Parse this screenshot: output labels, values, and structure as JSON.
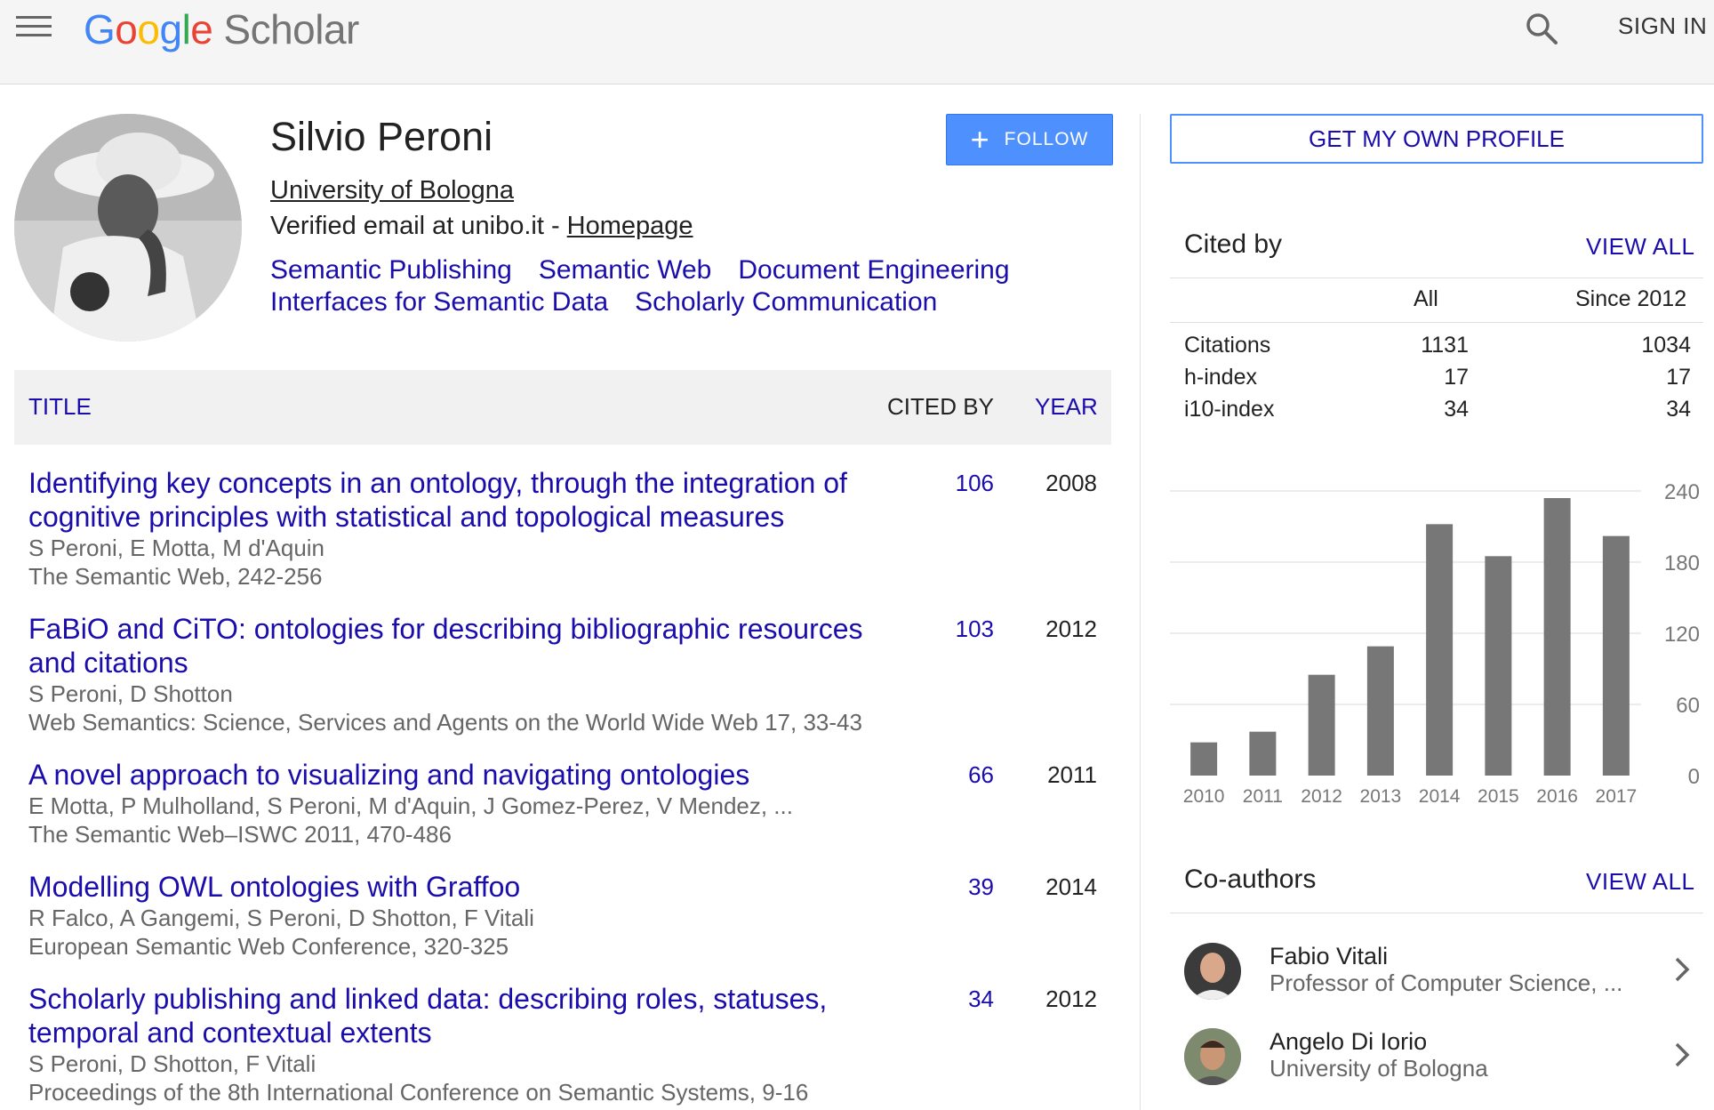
{
  "header": {
    "logo_google": [
      "G",
      "o",
      "o",
      "g",
      "l",
      "e"
    ],
    "logo_product": "Scholar",
    "sign_in": "SIGN IN"
  },
  "profile": {
    "name": "Silvio Peroni",
    "affiliation": "University of Bologna",
    "email_text": "Verified email at unibo.it - ",
    "homepage": "Homepage",
    "follow": "FOLLOW",
    "interests": [
      "Semantic Publishing",
      "Semantic Web",
      "Document Engineering",
      "Interfaces for Semantic Data",
      "Scholarly Communication"
    ]
  },
  "table": {
    "headers": {
      "title": "TITLE",
      "cited_by": "CITED BY",
      "year": "YEAR"
    },
    "rows": [
      {
        "title": "Identifying key concepts in an ontology, through the integration of cognitive principles with statistical and topological measures",
        "authors": "S Peroni, E Motta, M d'Aquin",
        "venue": "The Semantic Web, 242-256",
        "cited": "106",
        "year": "2008"
      },
      {
        "title": "FaBiO and CiTO: ontologies for describing bibliographic resources and citations",
        "authors": "S Peroni, D Shotton",
        "venue": "Web Semantics: Science, Services and Agents on the World Wide Web 17, 33-43",
        "cited": "103",
        "year": "2012"
      },
      {
        "title": "A novel approach to visualizing and navigating ontologies",
        "authors": "E Motta, P Mulholland, S Peroni, M d'Aquin, J Gomez-Perez, V Mendez, ...",
        "venue": "The Semantic Web–ISWC 2011, 470-486",
        "cited": "66",
        "year": "2011"
      },
      {
        "title": "Modelling OWL ontologies with Graffoo",
        "authors": "R Falco, A Gangemi, S Peroni, D Shotton, F Vitali",
        "venue": "European Semantic Web Conference, 320-325",
        "cited": "39",
        "year": "2014"
      },
      {
        "title": "Scholarly publishing and linked data: describing roles, statuses, temporal and contextual extents",
        "authors": "S Peroni, D Shotton, F Vitali",
        "venue": "Proceedings of the 8th International Conference on Semantic Systems, 9-16",
        "cited": "34",
        "year": "2012"
      }
    ]
  },
  "sidebar": {
    "get_profile": "GET MY OWN PROFILE",
    "cited_by_title": "Cited by",
    "view_all": "VIEW ALL",
    "col_all": "All",
    "col_since": "Since 2012",
    "stats": [
      {
        "label": "Citations",
        "all": "1131",
        "since": "1034"
      },
      {
        "label": "h-index",
        "all": "17",
        "since": "17"
      },
      {
        "label": "i10-index",
        "all": "34",
        "since": "34"
      }
    ],
    "coauthors_title": "Co-authors",
    "coauthors": [
      {
        "name": "Fabio Vitali",
        "affiliation": "Professor of Computer Science, ..."
      },
      {
        "name": "Angelo Di Iorio",
        "affiliation": "University of Bologna"
      }
    ]
  },
  "chart_data": {
    "type": "bar",
    "categories": [
      "2010",
      "2011",
      "2012",
      "2013",
      "2014",
      "2015",
      "2016",
      "2017"
    ],
    "values": [
      28,
      37,
      85,
      109,
      212,
      185,
      234,
      202
    ],
    "ylim": [
      0,
      240
    ],
    "yticks": [
      "0",
      "60",
      "120",
      "180",
      "240"
    ],
    "bar_color": "#777777",
    "grid": true
  },
  "colors": {
    "link": "#1a0dab",
    "accent": "#4d90fe"
  },
  "icons": [
    "menu-icon",
    "search-icon",
    "plus-icon",
    "chevron-right-icon"
  ]
}
